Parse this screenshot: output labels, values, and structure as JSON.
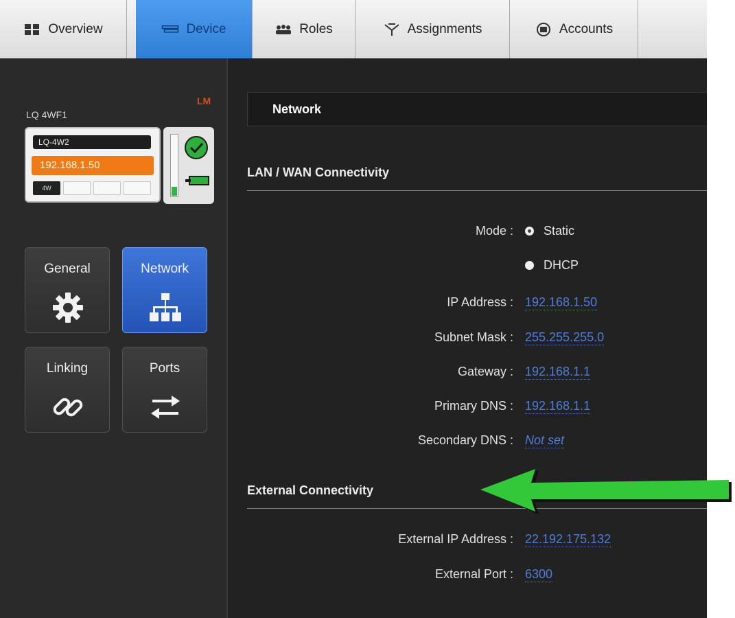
{
  "tabs": [
    {
      "label": "Overview",
      "icon": "grid-icon"
    },
    {
      "label": "Device",
      "icon": "device-icon",
      "active": true
    },
    {
      "label": "Roles",
      "icon": "people-icon"
    },
    {
      "label": "Assignments",
      "icon": "assignments-icon"
    },
    {
      "label": "Accounts",
      "icon": "accounts-icon"
    }
  ],
  "device": {
    "name": "LQ 4WF1",
    "badge": "LM",
    "model": "LQ-4W2",
    "ip": "192.168.1.50",
    "slot_label": "4W",
    "status": "ok",
    "level": 0.15
  },
  "nav_tiles": [
    {
      "label": "General",
      "icon": "gear-icon"
    },
    {
      "label": "Network",
      "icon": "network-icon",
      "active": true
    },
    {
      "label": "Linking",
      "icon": "link-icon"
    },
    {
      "label": "Ports",
      "icon": "swap-arrows-icon"
    }
  ],
  "section": {
    "title": "Network"
  },
  "lan": {
    "title": "LAN / WAN Connectivity",
    "mode_label": "Mode :",
    "mode_options": [
      "Static",
      "DHCP"
    ],
    "mode_selected": "Static",
    "fields": [
      {
        "label": "IP Address :",
        "value": "192.168.1.50"
      },
      {
        "label": "Subnet Mask :",
        "value": "255.255.255.0"
      },
      {
        "label": "Gateway :",
        "value": "192.168.1.1"
      },
      {
        "label": "Primary DNS :",
        "value": "192.168.1.1"
      },
      {
        "label": "Secondary DNS :",
        "value": "Not set"
      }
    ]
  },
  "external": {
    "title": "External Connectivity",
    "fields": [
      {
        "label": "External IP Address :",
        "value": "22.192.175.132"
      },
      {
        "label": "External Port :",
        "value": "6300"
      }
    ]
  },
  "colors": {
    "accent_blue": "#2f7fd6",
    "orange": "#f07b16",
    "link_blue": "#4f7dd8",
    "annotation_green": "#33c73a"
  }
}
